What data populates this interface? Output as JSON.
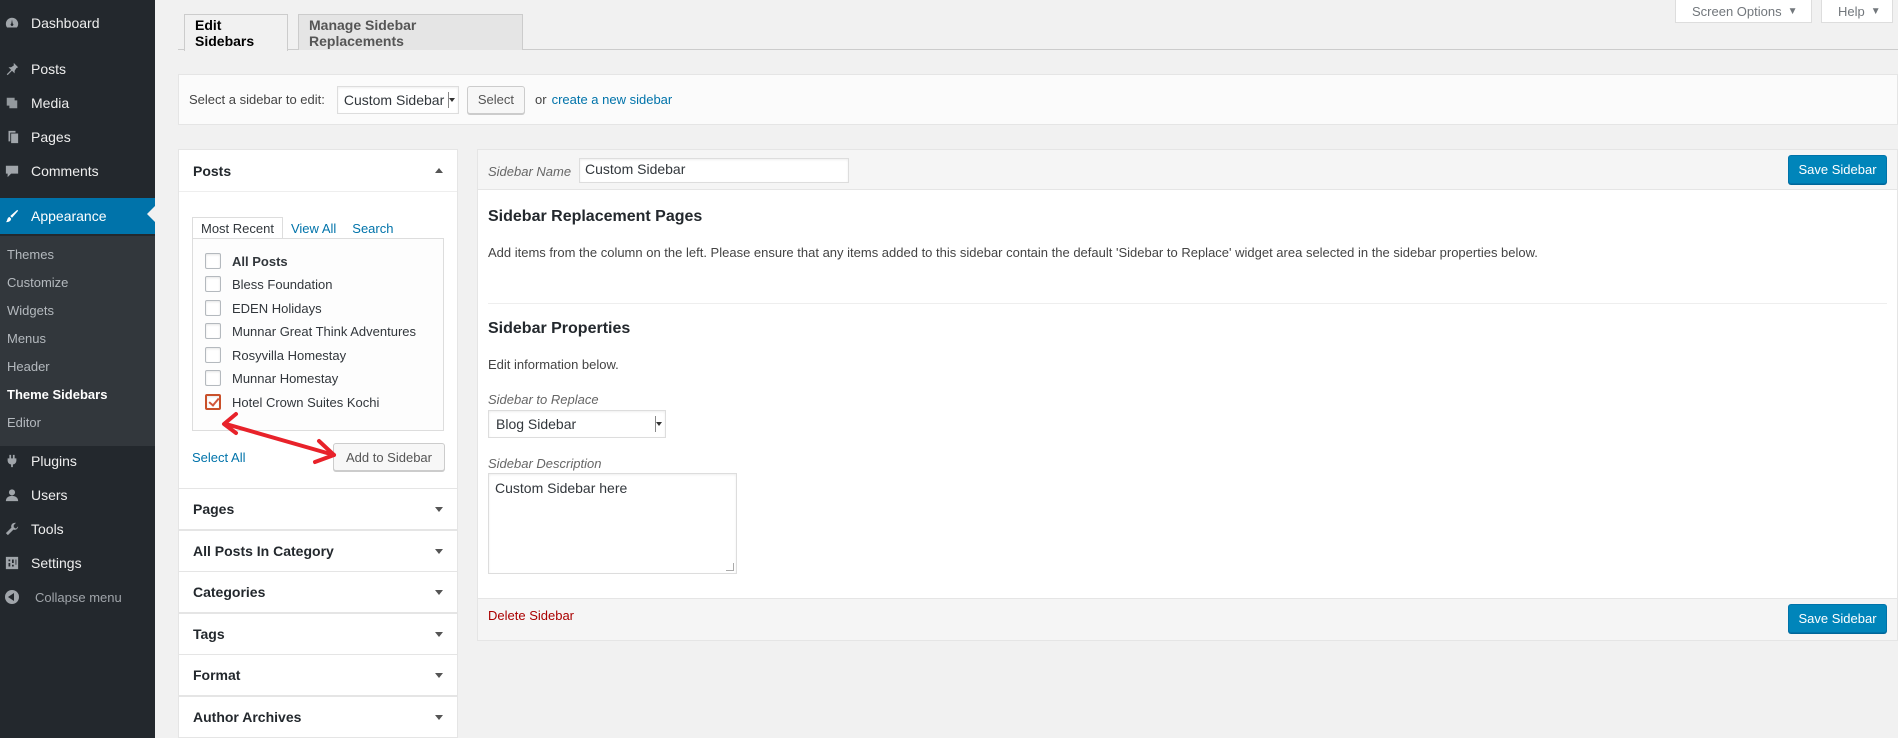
{
  "admin_menu": {
    "items": [
      {
        "label": "Dashboard",
        "icon": "dashboard-icon"
      },
      {
        "label": "Posts",
        "icon": "pin-icon"
      },
      {
        "label": "Media",
        "icon": "media-icon"
      },
      {
        "label": "Pages",
        "icon": "pages-icon"
      },
      {
        "label": "Comments",
        "icon": "comment-icon"
      },
      {
        "label": "Appearance",
        "icon": "brush-icon"
      }
    ],
    "submenu": [
      "Themes",
      "Customize",
      "Widgets",
      "Menus",
      "Header",
      "Theme Sidebars",
      "Editor"
    ],
    "items_bottom": [
      {
        "label": "Plugins",
        "icon": "plugin-icon"
      },
      {
        "label": "Users",
        "icon": "users-icon"
      },
      {
        "label": "Tools",
        "icon": "wrench-icon"
      },
      {
        "label": "Settings",
        "icon": "settings-icon"
      }
    ],
    "collapse_label": "Collapse menu"
  },
  "screen_meta": {
    "screen_options": "Screen Options",
    "help": "Help"
  },
  "tabs": {
    "edit": "Edit Sidebars",
    "manage": "Manage Sidebar Replacements"
  },
  "select_bar": {
    "label": "Select a sidebar to edit:",
    "selected": "Custom Sidebar",
    "select_button": "Select",
    "or_text": "or",
    "create_link": "create a new sidebar"
  },
  "posts_box": {
    "title": "Posts",
    "tabs": [
      "Most Recent",
      "View All",
      "Search"
    ],
    "items": [
      {
        "label": "All Posts",
        "checked": false
      },
      {
        "label": "Bless Foundation",
        "checked": false
      },
      {
        "label": "EDEN Holidays",
        "checked": false
      },
      {
        "label": "Munnar Great Think Adventures",
        "checked": false
      },
      {
        "label": "Rosyvilla Homestay",
        "checked": false
      },
      {
        "label": "Munnar Homestay",
        "checked": false
      },
      {
        "label": "Hotel Crown Suites Kochi",
        "checked": true
      }
    ],
    "select_all": "Select All",
    "add_button": "Add to Sidebar"
  },
  "closed_boxes": [
    "Pages",
    "All Posts In Category",
    "Categories",
    "Tags",
    "Format",
    "Author Archives"
  ],
  "right_panel": {
    "name_label": "Sidebar Name",
    "name_value": "Custom Sidebar",
    "save_label": "Save Sidebar",
    "replacement_title": "Sidebar Replacement Pages",
    "replacement_text": "Add items from the column on the left. Please ensure that any items added to this sidebar contain the default 'Sidebar to Replace' widget area selected in the sidebar properties below.",
    "properties_title": "Sidebar Properties",
    "properties_text": "Edit information below.",
    "replace_label": "Sidebar to Replace",
    "replace_value": "Blog Sidebar",
    "description_label": "Sidebar Description",
    "description_value": "Custom Sidebar here",
    "delete_label": "Delete Sidebar"
  },
  "colors": {
    "admin_bg": "#23282d",
    "accent": "#0073aa",
    "primary_button": "#0085ba",
    "annotation_arrow": "#e8222a",
    "delete_link": "#aa0000"
  }
}
